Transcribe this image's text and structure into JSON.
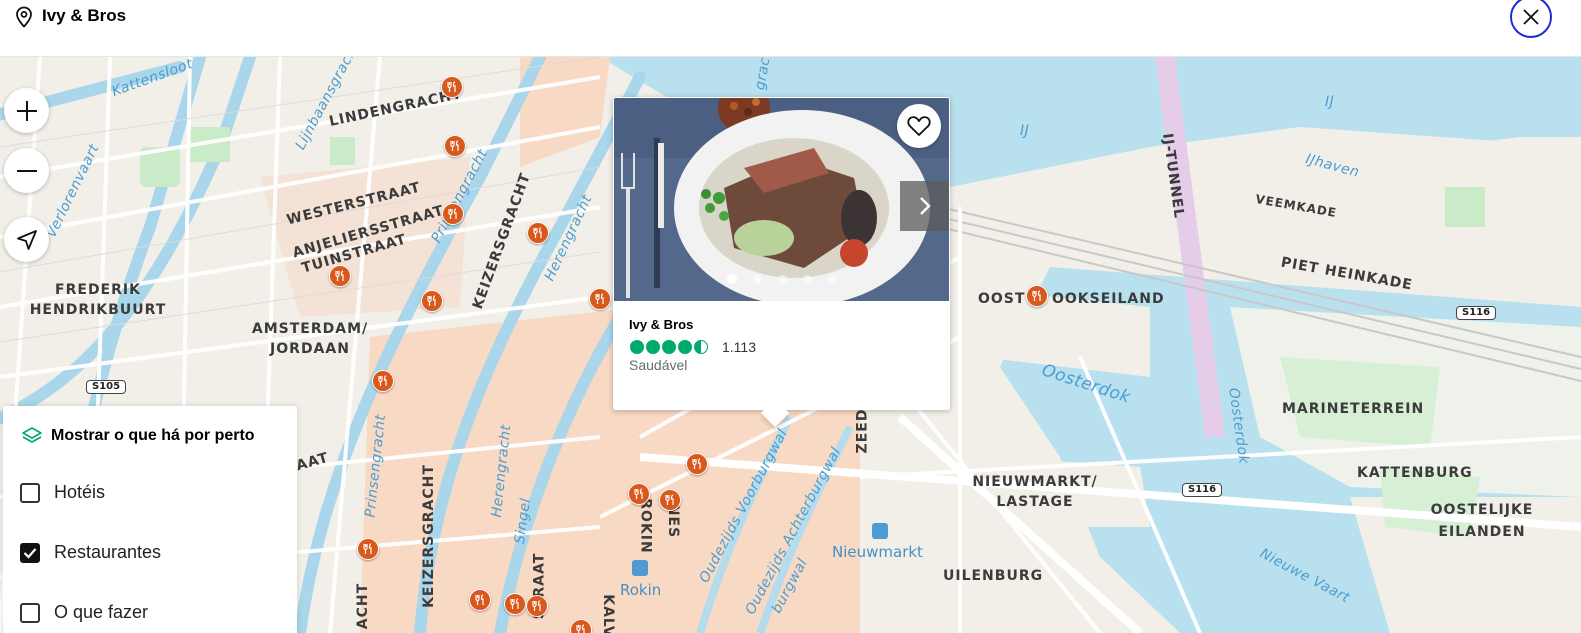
{
  "header": {
    "title": "Ivy & Bros",
    "location_icon": "map-pin-icon",
    "close_icon": "close-icon"
  },
  "map": {
    "labels": {
      "lindengracht": "LINDENGRACHT",
      "westerstraat": "WESTERSTRAAT",
      "anjeliersstraat": "ANJELIERSSTRAAT",
      "tuinstraat": "TUINSTRAAT",
      "frederik": "FREDERIK",
      "hendrikbuurt": "HENDRIKBUURT",
      "amsterdam": "AMSTERDAM/",
      "jordaan": "JORDAAN",
      "keizersgracht_1": "KEIZERSGRACHT",
      "keizersgracht_2": "KEIZERSGRACHT",
      "aat": "AAT",
      "straat": "STRAAT",
      "acht": "ACHT",
      "rokin_st": "ROKIN",
      "nes": "NES",
      "kalv": "KALV",
      "zeed": "ZEED",
      "oostenburg_part": "OOST",
      "oostelijk_rest": "OOKSEILAND",
      "veemkade": "VEEMKADE",
      "piet_heinkade": "PIET HEINKADE",
      "ij_tunnel": "IJ-TUNNEL",
      "marineterrein": "MARINETERREIN",
      "kattenburg": "KATTENBURG",
      "oostelijke": "OOSTELIJKE",
      "eilanden": "EILANDEN",
      "nieuwmarkt_lastage_1": "NIEUWMARKT/",
      "nieuwmarkt_lastage_2": "LASTAGE",
      "uilenburg": "UILENBURG",
      "nieuwmarkt_station": "Nieuwmarkt",
      "rokin_station": "Rokin"
    },
    "water_labels": {
      "kattensloot": "Kattensloot",
      "lijnbaansgracht": "Lijnbaansgracht",
      "prinsengracht_1": "Prinsengracht",
      "prinsengracht_2": "Prinsengracht",
      "herengracht_1": "Herengracht",
      "herengracht_2": "Herengracht",
      "singel": "Singel",
      "verlorenvaart": "Verlorenvaart",
      "oudezijds_voorburgwal": "Oudezijds Voorburgwal",
      "oudezijds_achterburgwal": "Oudezijds Achterburgwal",
      "ij": "IJ",
      "ij_2": "IJ",
      "ijhaven": "IJhaven",
      "oosterdok": "Oosterdok",
      "oosterdok_2": "Oosterdok",
      "nieuwe_vaart": "Nieuwe Vaart",
      "burgwal": "burgwal",
      "gracht_partial": "gracht"
    },
    "road_shields": {
      "s105": "S105",
      "s116_a": "S116",
      "s116_b": "S116"
    },
    "marker_icon": "restaurant-icon"
  },
  "controls": {
    "zoom_in_icon": "plus-icon",
    "zoom_out_icon": "minus-icon",
    "locate_icon": "navigation-arrow-icon"
  },
  "nearby": {
    "title": "Mostrar o que há por perto",
    "icon": "layers-icon",
    "options": [
      {
        "label": "Hotéis",
        "checked": false
      },
      {
        "label": "Restaurantes",
        "checked": true
      },
      {
        "label": "O que fazer",
        "checked": false
      }
    ]
  },
  "popup": {
    "name": "Ivy & Bros",
    "rating": 4.5,
    "review_count": "1.113",
    "category": "Saudável",
    "photo_index": 1,
    "photo_count": 5,
    "favorite_icon": "heart-icon",
    "next_icon": "chevron-right-icon"
  },
  "colors": {
    "marker": "#d9591c",
    "rating": "#00aa6c",
    "close_ring": "#1f2bd8",
    "water": "#b9e0ee",
    "land": "#f2efe9",
    "park": "#c9ebc7",
    "built_up": "#f7d9c4"
  }
}
